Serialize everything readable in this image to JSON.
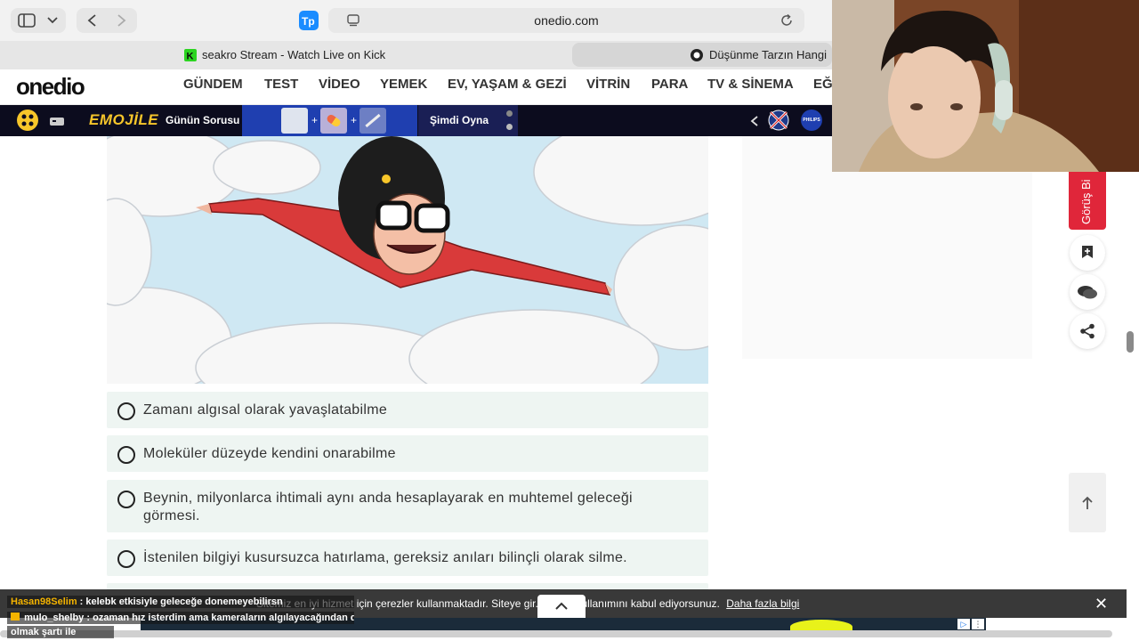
{
  "browser": {
    "url": "onedio.com",
    "tabs": [
      {
        "title": "seakro Stream - Watch Live on Kick"
      },
      {
        "title": "Düşünme Tarzın Hangi"
      }
    ]
  },
  "site": {
    "logo": "onedio",
    "nav": [
      "GÜNDEM",
      "TEST",
      "VİDEO",
      "YEMEK",
      "EV, YAŞAM & GEZİ",
      "VİTRİN",
      "PARA",
      "TV & SİNEMA",
      "EĞ"
    ]
  },
  "gamebar": {
    "brand": "EMOJİLE",
    "question_label": "Günün Sorusu",
    "play_label": "Şimdi Oyna",
    "sponsor": "PHILIPS"
  },
  "quiz": {
    "options": [
      "Zamanı algısal olarak yavaşlatabilme",
      "Moleküler düzeyde kendini onarabilme",
      "Beynin, milyonlarca ihtimali aynı anda hesaplayarak en muhtemel geleceği görmesi.",
      "İstenilen bilgiyi kusursuzca hatırlama, gereksiz anıları bilinçli olarak silme."
    ]
  },
  "sidebar": {
    "feedback_label": "Görüş Bi"
  },
  "cookie": {
    "text": "Sitemiz en iyi hizmet için çerezler kullanmaktadır. Siteye gir... çerez kullanımını kabul ediyorsunuz.",
    "link": "Daha fazla bilgi"
  },
  "chat": [
    {
      "user": "Hasan98Selim",
      "message": ": kelebk etkisiyle geleceğe donemeyebilirsn"
    },
    {
      "user": "mulo_shelby",
      "message": ": ozaman hız isterdim ama kameraların algılayacağından daha hızlı"
    },
    {
      "user": "",
      "message": "olmak şartı ile"
    }
  ]
}
